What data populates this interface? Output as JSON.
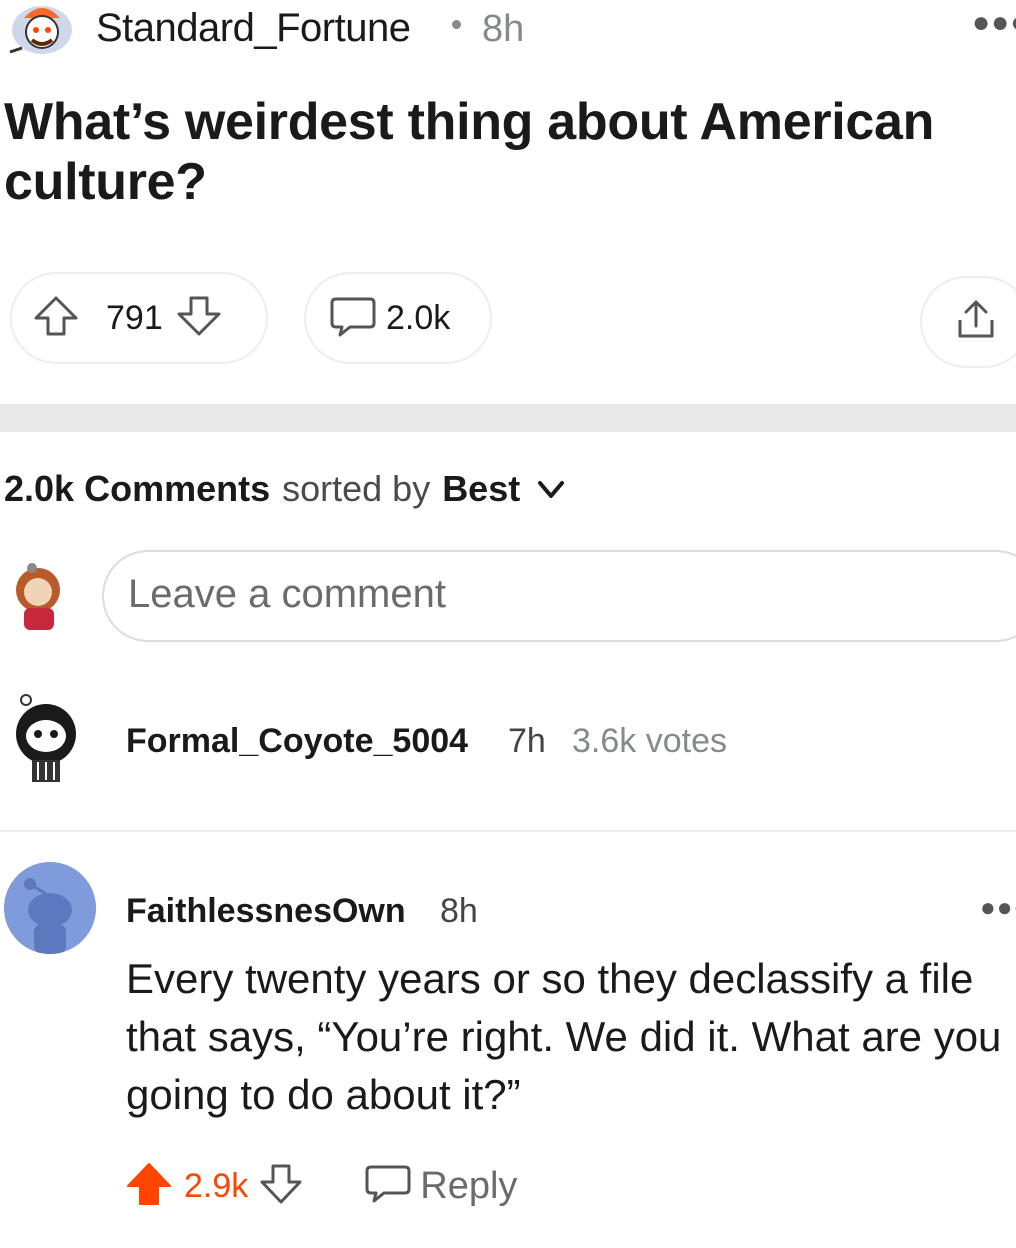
{
  "post": {
    "author": "Standard_Fortune",
    "time": "8h",
    "title": "What’s weirdest thing about American culture?",
    "score": "791",
    "comments": "2.0k"
  },
  "comments_header": {
    "count": "2.0k",
    "comments_label": "Comments",
    "sorted_by": "sorted by",
    "sort": "Best"
  },
  "composer": {
    "placeholder": "Leave a comment"
  },
  "comments": [
    {
      "author": "Formal_Coyote_5004",
      "time": "7h",
      "votes": "3.6k votes"
    },
    {
      "author": "FaithlessnesOwn",
      "time": "8h",
      "body": "Every twenty years or so they declassify a file that says, “You’re right. We did it. What are you going to do about it?”",
      "score": "2.9k",
      "reply_label": "Reply"
    }
  ],
  "icons": [
    "reddit-avatar-icon",
    "more-icon",
    "upvote-icon",
    "downvote-icon",
    "comment-icon",
    "share-icon",
    "chevron-down-icon",
    "reply-icon"
  ],
  "colors": {
    "upvote_active": "#ff4500",
    "muted": "#878a8c",
    "avatar_blue": "#7f9bdc"
  }
}
